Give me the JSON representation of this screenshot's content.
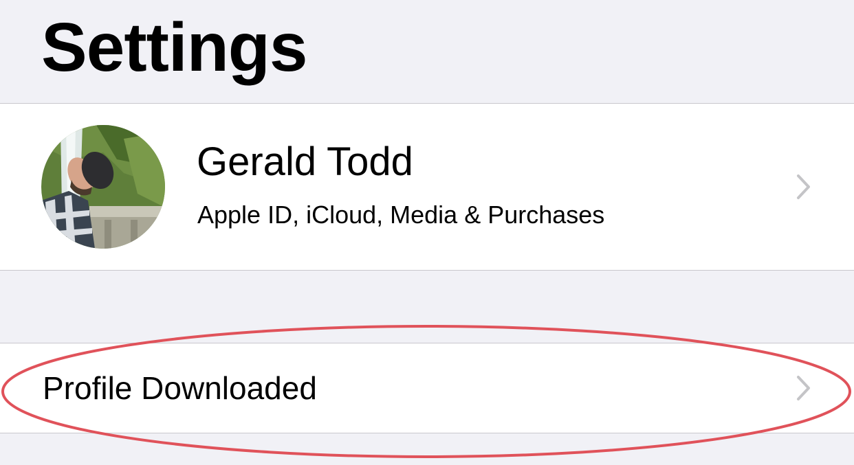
{
  "header": {
    "title": "Settings"
  },
  "account": {
    "name": "Gerald Todd",
    "subtitle": "Apple ID, iCloud, Media & Purchases"
  },
  "profile_row": {
    "label": "Profile Downloaded"
  },
  "colors": {
    "background": "#f1f1f6",
    "cell": "#ffffff",
    "separator": "#c8c7cc",
    "chevron": "#c4c4c7",
    "annotation": "#e0525a"
  },
  "icons": {
    "chevron": "chevron-right-icon",
    "avatar": "avatar-photo"
  }
}
